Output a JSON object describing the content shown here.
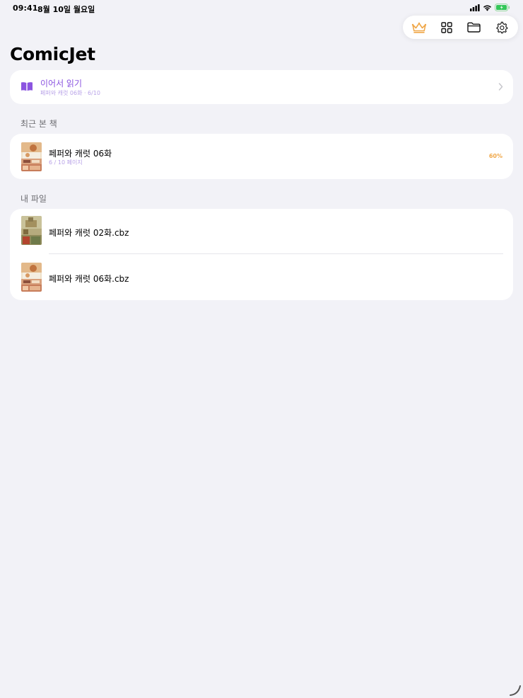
{
  "status_bar": {
    "time": "09:41",
    "date": "8월 10일 월요일"
  },
  "toolbar": {
    "icons": [
      "crown-icon",
      "grid-icon",
      "folder-icon",
      "gear-icon"
    ],
    "crown_color": "#f0a84a"
  },
  "app": {
    "title": "ComicJet"
  },
  "continue_reading": {
    "title": "이어서 읽기",
    "subtitle": "페퍼와 캐럿 06화 · 6/10",
    "accent_color": "#8b54e0"
  },
  "recent": {
    "header": "최근 본 책",
    "items": [
      {
        "title": "페퍼와 캐럿 06화",
        "pages": "6 / 10 페이지",
        "percent": "60%"
      }
    ]
  },
  "files": {
    "header": "내 파일",
    "items": [
      {
        "name": "페퍼와 캐럿 02화.cbz"
      },
      {
        "name": "페퍼와 캐럿 06화.cbz"
      }
    ]
  }
}
